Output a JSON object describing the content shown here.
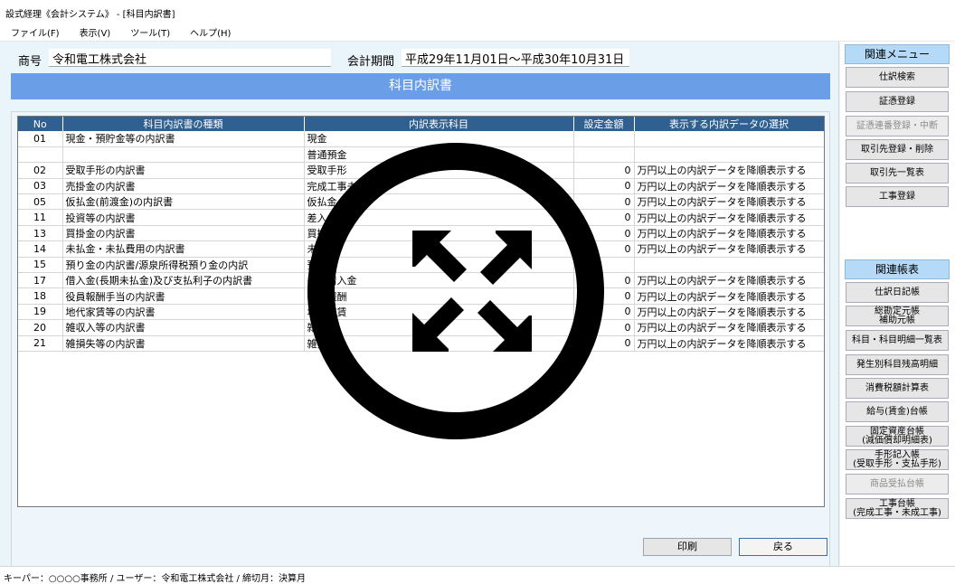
{
  "window": {
    "title": "設式経理《会計システム》 - [科目内訳書]"
  },
  "menu": [
    "ファイル(F)",
    "表示(V)",
    "ツール(T)",
    "ヘルプ(H)"
  ],
  "header": {
    "company_label": "商号",
    "company_value": "令和電工株式会社",
    "period_label": "会計期間",
    "period_value": "平成29年11月01日～平成30年10月31日"
  },
  "page_title": "科目内訳書",
  "table": {
    "columns": [
      "No",
      "科目内訳書の種類",
      "内訳表示科目",
      "設定金額",
      "表示する内訳データの選択"
    ],
    "rows": [
      {
        "no": "01",
        "kind": "現金・預貯金等の内訳書",
        "account": "現金",
        "amount": "",
        "select": ""
      },
      {
        "no": "",
        "kind": "",
        "account": "普通預金",
        "amount": "",
        "select": ""
      },
      {
        "no": "02",
        "kind": "受取手形の内訳書",
        "account": "受取手形",
        "amount": "0",
        "select": "万円以上の内訳データを降順表示する"
      },
      {
        "no": "03",
        "kind": "売掛金の内訳書",
        "account": "完成工事未収入金",
        "amount": "0",
        "select": "万円以上の内訳データを降順表示する"
      },
      {
        "no": "05",
        "kind": "仮払金(前渡金)の内訳書",
        "account": "仮払金",
        "amount": "0",
        "select": "万円以上の内訳データを降順表示する"
      },
      {
        "no": "11",
        "kind": "投資等の内訳書",
        "account": "差入保証金",
        "amount": "0",
        "select": "万円以上の内訳データを降順表示する"
      },
      {
        "no": "13",
        "kind": "買掛金の内訳書",
        "account": "買掛金",
        "amount": "0",
        "select": "万円以上の内訳データを降順表示する"
      },
      {
        "no": "14",
        "kind": "未払金・未払費用の内訳書",
        "account": "未払金",
        "amount": "0",
        "select": "万円以上の内訳データを降順表示する"
      },
      {
        "no": "15",
        "kind": "預り金の内訳書/源泉所得税預り金の内訳",
        "account": "預り金",
        "amount": "",
        "select": ""
      },
      {
        "no": "17",
        "kind": "借入金(長期未払金)及び支払利子の内訳書",
        "account": "長期借入金",
        "amount": "0",
        "select": "万円以上の内訳データを降順表示する"
      },
      {
        "no": "18",
        "kind": "役員報酬手当の内訳書",
        "account": "役員報酬",
        "amount": "0",
        "select": "万円以上の内訳データを降順表示する"
      },
      {
        "no": "19",
        "kind": "地代家賃等の内訳書",
        "account": "地代家賃",
        "amount": "0",
        "select": "万円以上の内訳データを降順表示する"
      },
      {
        "no": "20",
        "kind": "雑収入等の内訳書",
        "account": "雑収入",
        "amount": "0",
        "select": "万円以上の内訳データを降順表示する"
      },
      {
        "no": "21",
        "kind": "雑損失等の内訳書",
        "account": "雑損失",
        "amount": "0",
        "select": "万円以上の内訳データを降順表示する"
      }
    ]
  },
  "buttons": {
    "print": "印刷",
    "back": "戻る"
  },
  "sidebar": {
    "menu_title": "関連メニュー",
    "menu_items": [
      "仕訳検索",
      "証憑登録",
      "証憑連番登録・中断",
      "取引先登録・削除",
      "取引先一覧表",
      "工事登録"
    ],
    "report_title": "関連帳表",
    "report_items": [
      "仕訳日記帳",
      "総勘定元帳\n補助元帳",
      "科目・科目明細一覧表",
      "発生別科目残高明細",
      "消費税額計算表",
      "給与(賃金)台帳",
      "固定資産台帳\n(減価償却明細表)",
      "手形記入帳\n(受取手形・支払手形)",
      "商品受払台帳",
      "工事台帳\n(完成工事・未成工事)"
    ]
  },
  "statusbar": "キーパー：○○○○事務所 / ユーザー：令和電工株式会社 / 締切月：決算月",
  "overlay_icon": "expand-arrows-icon"
}
